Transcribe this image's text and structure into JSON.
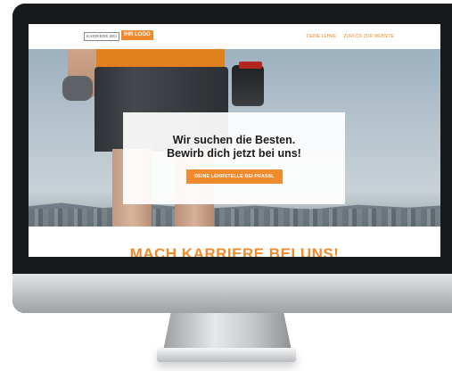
{
  "header": {
    "logo_left": "KARRIERE BEI",
    "logo_right": "IHR LOGO",
    "nav": [
      "DEINE LEHRE",
      "ZURÜCK ZUR WEBSITE"
    ]
  },
  "hero": {
    "headline_line1": "Wir suchen die Besten.",
    "headline_line2": "Bewirb dich jetzt bei uns!",
    "button_label": "DEINE LEHRSTELLE BEI PRASSL"
  },
  "section": {
    "headline": "MACH KARRIERE BEI UNS!"
  },
  "colors": {
    "accent": "#f08a2c",
    "text_dark": "#1c1c1c",
    "bezel": "#17191b"
  }
}
